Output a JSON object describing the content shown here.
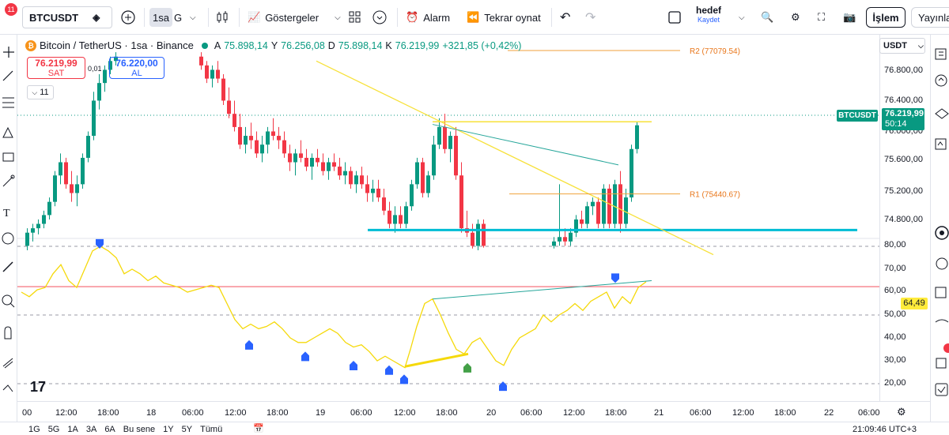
{
  "topbar": {
    "notification_count": "11",
    "symbol": "BTCUSDT",
    "interval": "1sa",
    "chart_type_letter": "G",
    "indicators_label": "Göstergeler",
    "alarm_label": "Alarm",
    "replay_label": "Tekrar oynat",
    "layout_name": "hedef",
    "save_label": "Kaydet",
    "trade_label": "İşlem",
    "publish_label": "Yayınla"
  },
  "legend": {
    "title": "Bitcoin / TetherUS · 1sa · Binance",
    "open_label": "A",
    "open": "75.898,14",
    "high_label": "Y",
    "high": "76.256,08",
    "low_label": "D",
    "low": "75.898,14",
    "close_label": "K",
    "close": "76.219,99",
    "change": "+321,85 (+0,42%)"
  },
  "trade": {
    "sell_price": "76.219,99",
    "sell_label": "SAT",
    "spread": "0,01",
    "buy_price": "76.220,00",
    "buy_label": "AL",
    "indicator_count": "11"
  },
  "price_scale": {
    "currency": "USDT",
    "ticks": [
      "76.800,00",
      "76.400,00",
      "76.000,00",
      "75.600,00",
      "75.200,00",
      "74.800,00"
    ],
    "rsi_ticks": [
      "80,00",
      "70,00",
      "60,00",
      "50,00",
      "40,00",
      "30,00",
      "20,00"
    ],
    "current_symbol": "BTCUSDT",
    "current_price": "76.219,99",
    "countdown": "50:14",
    "rsi_value": "64,49"
  },
  "annotations": {
    "r2": "R2 (77079.54)",
    "r1": "R1 (75440.67)"
  },
  "time_axis": [
    "00",
    "12:00",
    "18:00",
    "18",
    "06:00",
    "12:00",
    "18:00",
    "19",
    "06:00",
    "12:00",
    "18:00",
    "20",
    "06:00",
    "12:00",
    "18:00",
    "21",
    "06:00",
    "12:00",
    "18:00",
    "22",
    "06:00"
  ],
  "bottombar": {
    "ranges": [
      "1G",
      "5G",
      "1A",
      "3A",
      "6A",
      "Bu sene",
      "1Y",
      "5Y",
      "Tümü"
    ],
    "clock": "21:09:46 UTC+3"
  },
  "colors": {
    "up": "#089981",
    "down": "#f23645",
    "rsi": "#f5d90a",
    "trendline": "#f7e13a",
    "support": "#00bcd4",
    "pivot": "#f0a23b"
  }
}
